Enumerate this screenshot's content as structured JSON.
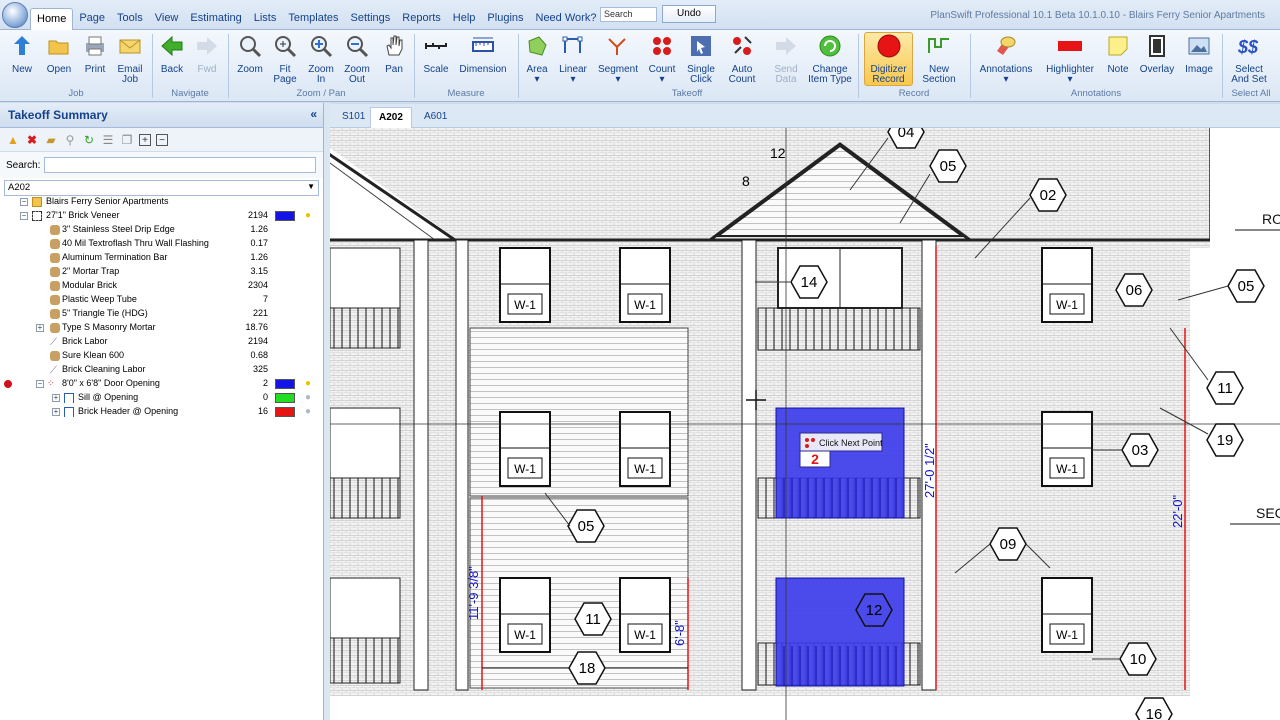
{
  "app_title": "PlanSwift Professional 10.1 Beta  10.1.0.10 - Blairs Ferry Senior Apartments",
  "menu_tabs": [
    "Home",
    "Page",
    "Tools",
    "View",
    "Estimating",
    "Lists",
    "Templates",
    "Settings",
    "Reports",
    "Help",
    "Plugins",
    "Need Work?"
  ],
  "search_placeholder": "Search",
  "undo_label": "Undo",
  "ribbon": {
    "groups": [
      "Job",
      "Navigate",
      "Zoom / Pan",
      "Measure",
      "Takeoff",
      "Record",
      "Annotations",
      "Select All"
    ],
    "buttons": {
      "new": "New",
      "open": "Open",
      "print": "Print",
      "email": "Email",
      "email2": "Job",
      "back": "Back",
      "fwd": "Fwd",
      "zoom": "Zoom",
      "fit": "Fit",
      "fit2": "Page",
      "zoomin": "Zoom",
      "zoomin2": "In",
      "zoomout": "Zoom",
      "zoomout2": "Out",
      "pan": "Pan",
      "scale": "Scale",
      "dimension": "Dimension",
      "area": "Area",
      "linear": "Linear",
      "segment": "Segment",
      "count": "Count",
      "single": "Single",
      "single2": "Click",
      "auto": "Auto",
      "auto2": "Count",
      "send": "Send",
      "send2": "Data",
      "change": "Change",
      "change2": "Item Type",
      "digitizer": "Digitizer",
      "digitizer2": "Record",
      "newsection": "New",
      "newsection2": "Section",
      "annotations": "Annotations",
      "highlighter": "Highlighter",
      "note": "Note",
      "overlay": "Overlay",
      "image": "Image",
      "selectand": "Select",
      "selectand2": "And Set"
    }
  },
  "panel": {
    "title": "Takeoff Summary",
    "search_label": "Search:",
    "page_selected": "A202",
    "tree": [
      {
        "label": "Blairs Ferry Senior Apartments",
        "qty": "",
        "level": 0,
        "type": "folder"
      },
      {
        "label": "27'1\" Brick Veneer",
        "qty": "2194",
        "level": 1,
        "type": "area",
        "color": "#1414e6"
      },
      {
        "label": "3\" Stainless Steel Drip Edge",
        "qty": "1.26",
        "level": 2,
        "type": "part"
      },
      {
        "label": "40 Mil Textroflash Thru Wall Flashing",
        "qty": "0.17",
        "level": 2,
        "type": "part"
      },
      {
        "label": "Aluminum Termination Bar",
        "qty": "1.26",
        "level": 2,
        "type": "part"
      },
      {
        "label": "2\" Mortar Trap",
        "qty": "3.15",
        "level": 2,
        "type": "part"
      },
      {
        "label": "Modular Brick",
        "qty": "2304",
        "level": 2,
        "type": "part"
      },
      {
        "label": "Plastic Weep Tube",
        "qty": "7",
        "level": 2,
        "type": "part"
      },
      {
        "label": "5\" Triangle Tie (HDG)",
        "qty": "221",
        "level": 2,
        "type": "part"
      },
      {
        "label": "Type S Masonry Mortar",
        "qty": "18.76",
        "level": 2,
        "type": "assembly"
      },
      {
        "label": "Brick Labor",
        "qty": "2194",
        "level": 2,
        "type": "labor"
      },
      {
        "label": "Sure Klean 600",
        "qty": "0.68",
        "level": 2,
        "type": "part"
      },
      {
        "label": "Brick Cleaning Labor",
        "qty": "325",
        "level": 2,
        "type": "labor"
      },
      {
        "label": "8'0\" x 6'8\" Door Opening",
        "qty": "2",
        "level": 1,
        "type": "count",
        "color": "#1414e6"
      },
      {
        "label": "Sill @ Opening",
        "qty": "0",
        "level": 2,
        "type": "linear",
        "color": "#22dd22"
      },
      {
        "label": "Brick Header @ Opening",
        "qty": "16",
        "level": 2,
        "type": "linear",
        "color": "#e61414"
      }
    ]
  },
  "page_tabs": [
    "S101",
    "A202",
    "A601"
  ],
  "drawing": {
    "callout_text": "Click Next Point",
    "callout_number": "2",
    "window_tag": "W-1",
    "dims": {
      "d1": "12",
      "d2": "8",
      "d3": "27'-0 1/2\"",
      "d4": "22'-0\"",
      "d5": "11'-9 3/8\"",
      "d6": "6'-8\""
    },
    "tags": [
      "04",
      "05",
      "02",
      "14",
      "06",
      "05",
      "11",
      "19",
      "03",
      "05",
      "09",
      "11",
      "12",
      "18",
      "10",
      "16"
    ],
    "side_labels": {
      "r1": "RO",
      "r2": "SEC"
    }
  }
}
